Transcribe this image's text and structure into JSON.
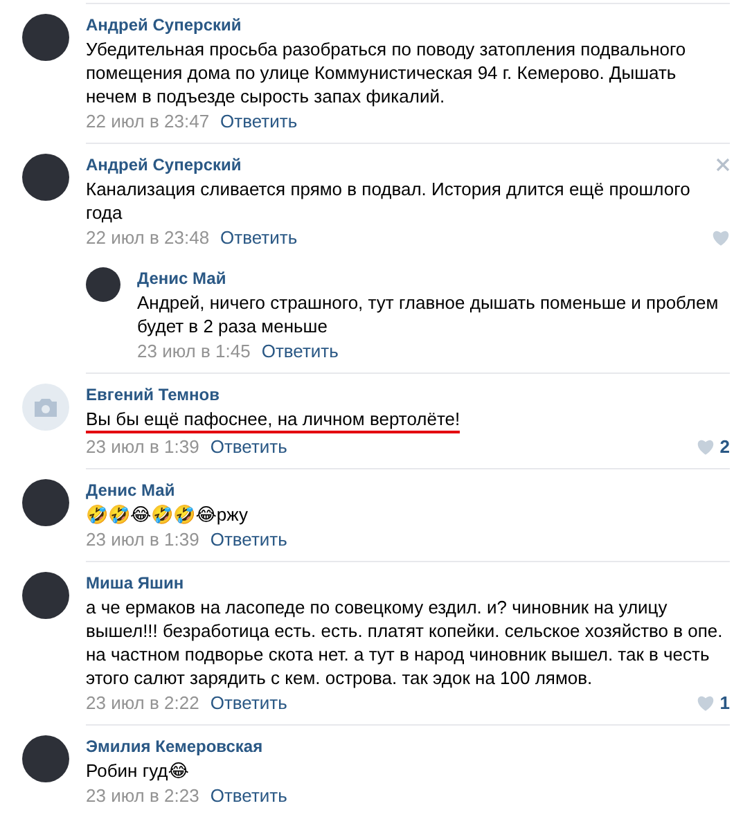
{
  "comments": [
    {
      "author": "Андрей Суперский",
      "photo": true,
      "text": "Убедительная просьба разобраться по поводу затопления подвального помещения дома по улице Коммунистическая 94 г. Кемерово. Дышать нечем в подъезде сырость запах фикалий.",
      "time": "22 июл в 23:47",
      "reply": "Ответить",
      "close": false,
      "heart": false,
      "underlined": false
    },
    {
      "author": "Андрей Суперский",
      "photo": true,
      "text": "Канализация сливается прямо в подвал. История длится ещё прошлого года",
      "time": "22 июл в 23:48",
      "reply": "Ответить",
      "close": true,
      "heart": true,
      "underlined": false,
      "children": [
        {
          "author": "Денис Май",
          "photo": true,
          "text": "Андрей, ничего страшного, тут главное дышать поменьше и проблем будет в 2 раза меньше",
          "time": "23 июл в 1:45",
          "reply": "Ответить",
          "close": false,
          "heart": false,
          "underlined": false
        }
      ]
    },
    {
      "author": "Евгений Темнов",
      "photo": false,
      "text": "Вы бы ещё пафоснее, на личном вертолёте!",
      "time": "23 июл в 1:39",
      "reply": "Ответить",
      "close": false,
      "heart": true,
      "likes": "2",
      "underlined": true
    },
    {
      "author": "Денис Май",
      "photo": true,
      "text": "🤣🤣😂🤣🤣😂ржу",
      "time": "23 июл в 1:39",
      "reply": "Ответить",
      "close": false,
      "heart": false,
      "underlined": false
    },
    {
      "author": "Миша Яшин",
      "photo": true,
      "text": "а че ермаков на ласопеде по совецкому ездил. и? чиновник на улицу вышел!!! безработица есть. есть. платят копейки. сельское хозяйство в опе. на частном подворье скота нет. а тут в народ чиновник вышел. так в честь этого салют зарядить с кем. острова. так эдок на 100 лямов.",
      "time": "23 июл в 2:22",
      "reply": "Ответить",
      "close": false,
      "heart": true,
      "likes": "1",
      "underlined": false
    },
    {
      "author": "Эмилия Кемеровская",
      "photo": true,
      "text": "Робин гуд😂",
      "time": "23 июл в 2:23",
      "reply": "Ответить",
      "close": false,
      "heart": false,
      "underlined": false
    }
  ]
}
